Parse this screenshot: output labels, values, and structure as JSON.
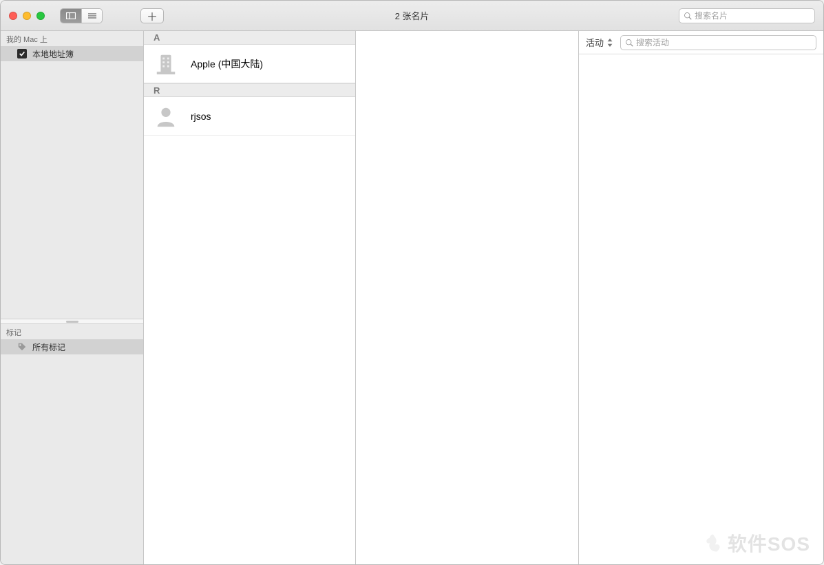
{
  "window": {
    "title": "2 张名片",
    "searchPlaceholder": "搜索名片"
  },
  "sidebar": {
    "sectionTop": "我的 Mac 上",
    "localBook": "本地地址簿",
    "sectionTags": "标记",
    "allTags": "所有标记"
  },
  "contacts": {
    "groups": [
      {
        "letter": "A",
        "items": [
          {
            "name": "Apple (中国大陆)",
            "icon": "building"
          }
        ]
      },
      {
        "letter": "R",
        "items": [
          {
            "name": "rjsos",
            "icon": "person"
          }
        ]
      }
    ]
  },
  "activity": {
    "label": "活动",
    "searchPlaceholder": "搜索活动"
  },
  "watermark": {
    "text": "软件SOS"
  }
}
